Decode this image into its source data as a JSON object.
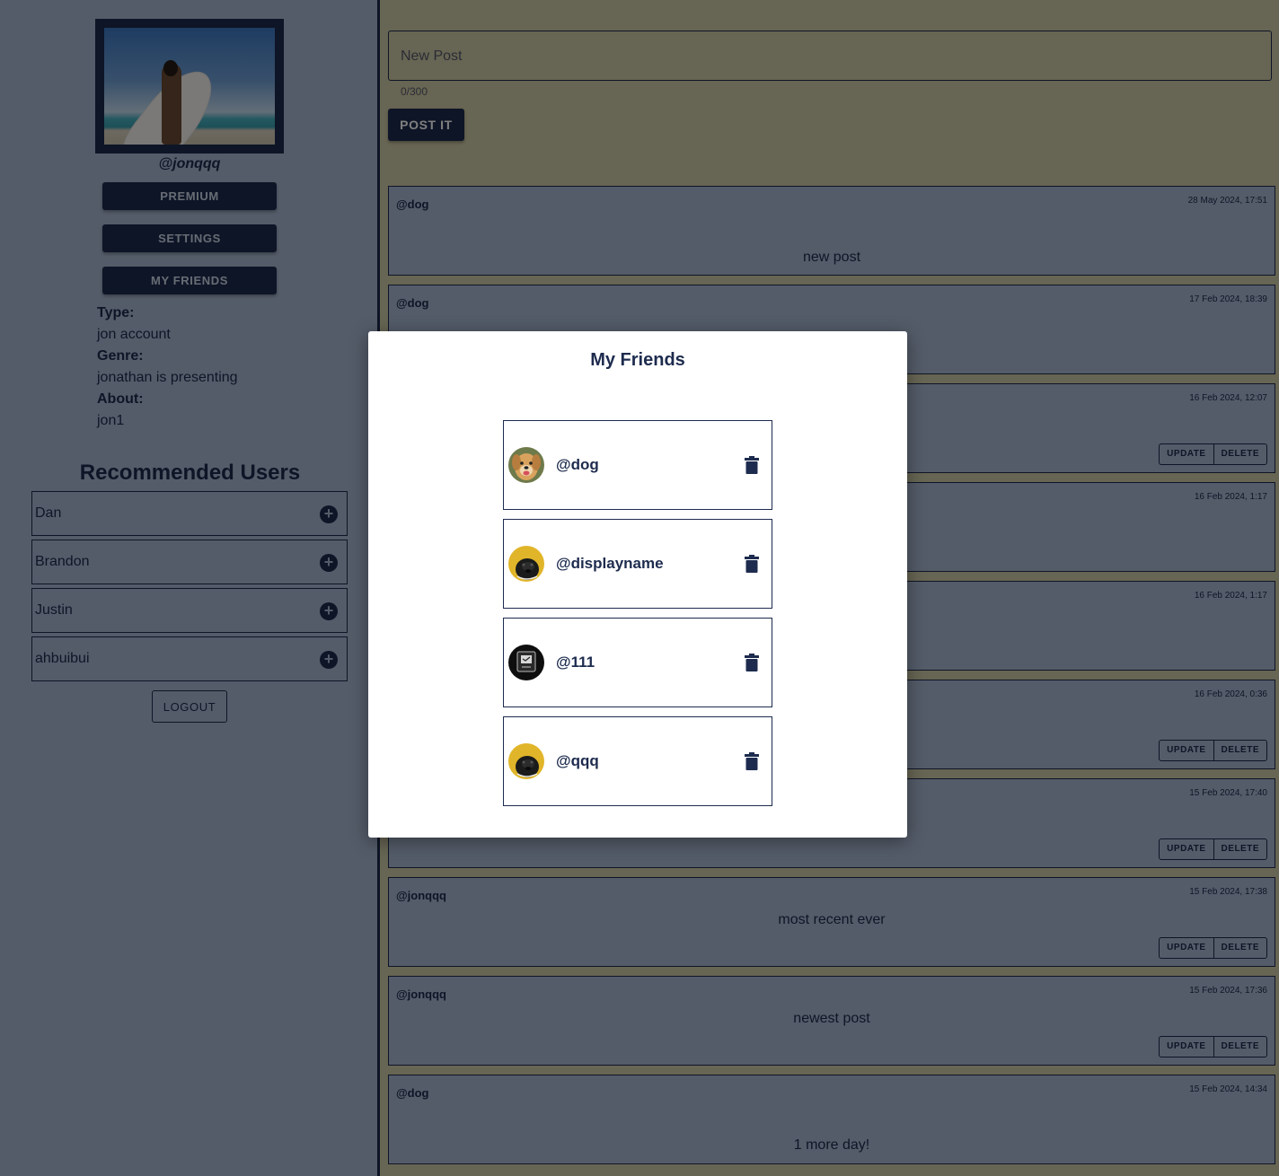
{
  "profile": {
    "username": "@jonqqq",
    "photo_icon": "surfer-photo",
    "buttons": {
      "premium": "PREMIUM",
      "settings": "SETTINGS",
      "my_friends": "MY FRIENDS"
    },
    "type_label": "Type:",
    "type_value": "jon account",
    "genre_label": "Genre:",
    "genre_value": "jonathan is presenting",
    "about_label": "About:",
    "about_value": "jon1"
  },
  "recommended": {
    "title": "Recommended Users",
    "users": [
      "Dan",
      "Brandon",
      "Justin",
      "ahbuibui"
    ],
    "add_icon": "plus-circle-icon"
  },
  "logout_label": "LOGOUT",
  "new_post": {
    "placeholder": "New Post",
    "counter": "0/300",
    "submit_label": "POST IT"
  },
  "posts": [
    {
      "author": "@dog",
      "date": "28 May 2024, 17:51",
      "body": "new post"
    },
    {
      "author": "@dog",
      "date": "17 Feb 2024, 18:39",
      "body": ""
    },
    {
      "author": "",
      "date": "16 Feb 2024, 12:07",
      "body": "",
      "update": "UPDATE",
      "delete": "DELETE"
    },
    {
      "author": "",
      "date": "16 Feb 2024, 1:17",
      "body": ""
    },
    {
      "author": "",
      "date": "16 Feb 2024, 1:17",
      "body": ""
    },
    {
      "author": "",
      "date": "16 Feb 2024, 0:36",
      "body": "",
      "update": "UPDATE",
      "delete": "DELETE"
    },
    {
      "author": "",
      "date": "15 Feb 2024, 17:40",
      "body": "",
      "update": "UPDATE",
      "delete": "DELETE"
    },
    {
      "author": "@jonqqq",
      "date": "15 Feb 2024, 17:38",
      "body": "most recent ever",
      "update": "UPDATE",
      "delete": "DELETE"
    },
    {
      "author": "@jonqqq",
      "date": "15 Feb 2024, 17:36",
      "body": "newest post",
      "update": "UPDATE",
      "delete": "DELETE"
    },
    {
      "author": "@dog",
      "date": "15 Feb 2024, 14:34",
      "body": "1 more day!"
    }
  ],
  "modal": {
    "title": "My Friends",
    "friends": [
      {
        "name": "@dog",
        "avatar": "dog-avatar"
      },
      {
        "name": "@displayname",
        "avatar": "black-dog-avatar"
      },
      {
        "name": "@111",
        "avatar": "dark-avatar"
      },
      {
        "name": "@qqq",
        "avatar": "black-dog-avatar"
      }
    ],
    "remove_icon": "trash-icon"
  },
  "colors": {
    "navy": "#1d2b4e",
    "sidebar": "#a8b8d2",
    "page": "#cfcaa6",
    "modal": "#ffffff"
  }
}
